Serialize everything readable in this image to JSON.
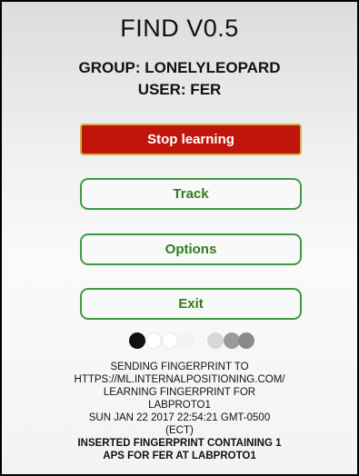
{
  "app": {
    "title": "FIND V0.5",
    "group_line": "GROUP: LONELYLEOPARD",
    "user_line": "USER: FER"
  },
  "buttons": {
    "stop_learning": "Stop learning",
    "track": "Track",
    "options": "Options",
    "exit": "Exit"
  },
  "colors": {
    "stop_bg": "#c0150b",
    "button_text_green": "#2e7d1c",
    "button_border_green": "#3f9a3f",
    "dot_black": "#111111",
    "dot_white": "#ffffff",
    "dot_grey": "#8a8a8a",
    "dot_light": "#d8d8d8"
  },
  "status": {
    "line1": "SENDING FINGERPRINT TO",
    "line2": "HTTPS://ML.INTERNALPOSITIONING.COM/",
    "line3": "LEARNING FINGERPRINT FOR",
    "line4": "LABPROTO1",
    "line5": "SUN JAN 22 2017 22:54:21 GMT-0500",
    "line6": "(ECT)",
    "line7": "INSERTED FINGERPRINT CONTAINING 1",
    "line8": "APS FOR FER AT LABPROTO1"
  }
}
